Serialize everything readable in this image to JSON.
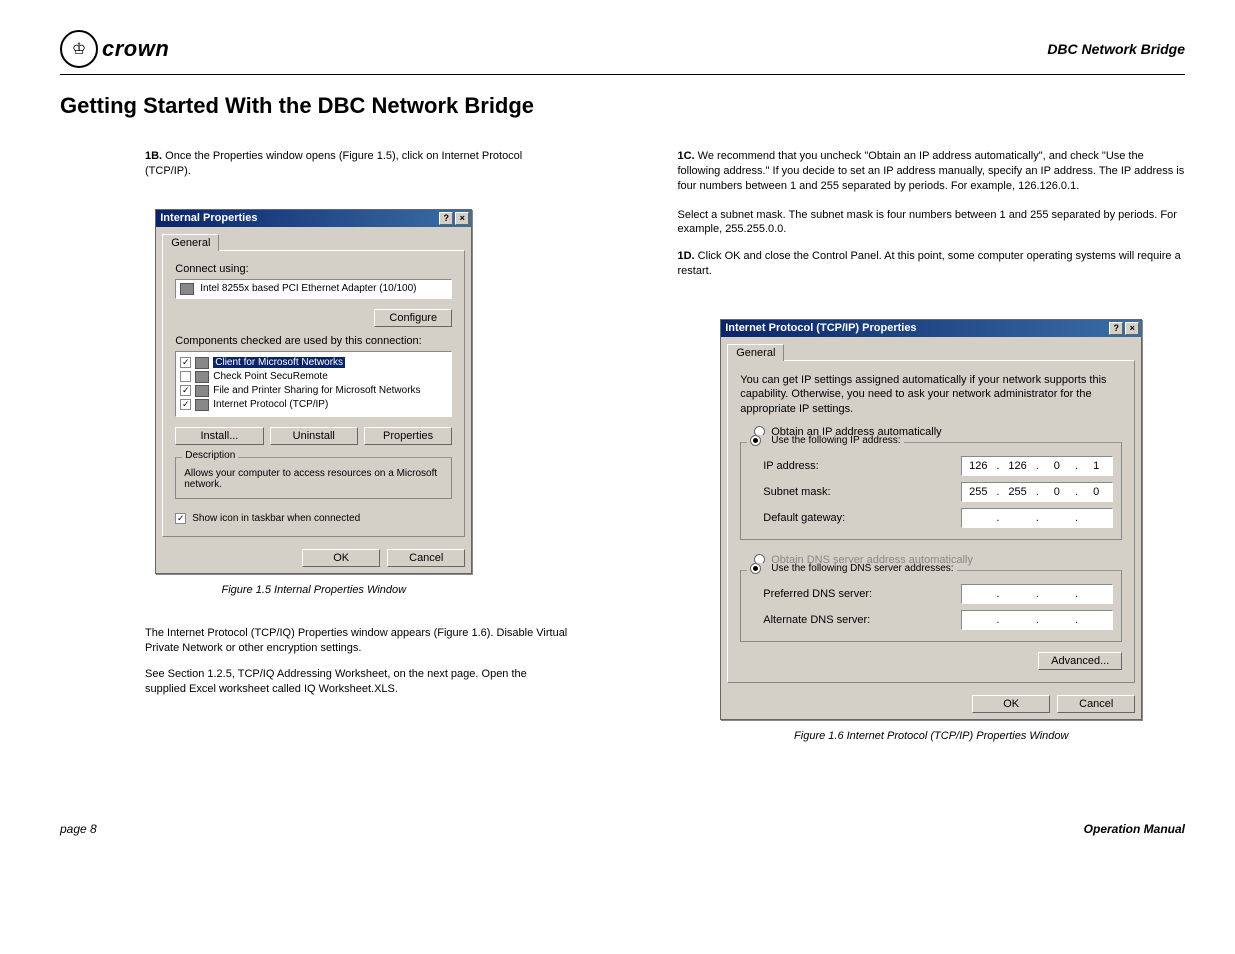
{
  "header": {
    "brand": "crown",
    "title": "DBC Network Bridge"
  },
  "h1": "Getting Started With the DBC Network Bridge",
  "left": {
    "step1b_label": "1B.",
    "step1b_text": " Once the Properties window opens (Figure 1.5), click on Internet Protocol (TCP/IP).",
    "dlg1": {
      "title": "Internal Properties",
      "tab": "General",
      "connect_label": "Connect using:",
      "adapter": "Intel 8255x based PCI Ethernet Adapter (10/100)",
      "configure": "Configure",
      "components_label": "Components checked are used by this connection:",
      "items": [
        {
          "checked": true,
          "name": "Client for Microsoft Networks",
          "selected": true
        },
        {
          "checked": false,
          "name": "Check Point SecuRemote"
        },
        {
          "checked": true,
          "name": "File and Printer Sharing for Microsoft Networks"
        },
        {
          "checked": true,
          "name": "Internet Protocol (TCP/IP)"
        }
      ],
      "install": "Install...",
      "uninstall": "Uninstall",
      "properties": "Properties",
      "desc_title": "Description",
      "desc_text": "Allows your computer to access resources on a Microsoft network.",
      "show_icon": "Show icon in taskbar when connected",
      "ok": "OK",
      "cancel": "Cancel"
    },
    "caption1": "Figure 1.5 Internal Properties Window",
    "para1": "The Internet Protocol (TCP/IQ) Properties window appears (Figure 1.6). Disable Virtual Private Network or other encryption settings.",
    "para2": "See Section 1.2.5, TCP/IQ Addressing Worksheet, on the next page. Open the supplied Excel worksheet called IQ Worksheet.XLS."
  },
  "right": {
    "step1c_label": "1C.",
    "step1c_text": " We recommend that you uncheck \"Obtain an IP address automatically\", and check \"Use the following address.\" If you decide to set an IP address manually, specify an IP address. The IP address is four numbers between 1 and 255 separated by periods. For example, 126.126.0.1.",
    "para_subnet": "Select a subnet mask. The subnet mask is four numbers between 1 and 255 separated by periods. For example, 255.255.0.0.",
    "step1d_label": "1D.",
    "step1d_text": " Click OK and close the Control Panel. At this point, some computer operating systems will require a restart.",
    "dlg2": {
      "title": "Internet Protocol (TCP/IP) Properties",
      "tab": "General",
      "intro": "You can get IP settings assigned automatically if your network supports this capability. Otherwise, you need to ask your network administrator for the appropriate IP settings.",
      "r_auto_ip": "Obtain an IP address automatically",
      "r_use_ip": "Use the following IP address:",
      "ip_label": "IP address:",
      "ip_vals": [
        "126",
        "126",
        "0",
        "1"
      ],
      "subnet_label": "Subnet mask:",
      "subnet_vals": [
        "255",
        "255",
        "0",
        "0"
      ],
      "gateway_label": "Default gateway:",
      "r_auto_dns": "Obtain DNS server address automatically",
      "r_use_dns": "Use the following DNS server addresses:",
      "pref_dns": "Preferred DNS server:",
      "alt_dns": "Alternate DNS server:",
      "advanced": "Advanced...",
      "ok": "OK",
      "cancel": "Cancel"
    },
    "caption2": "Figure 1.6 Internet Protocol (TCP/IP) Properties Window"
  },
  "footer": {
    "left": "page 8",
    "right": "Operation Manual"
  }
}
